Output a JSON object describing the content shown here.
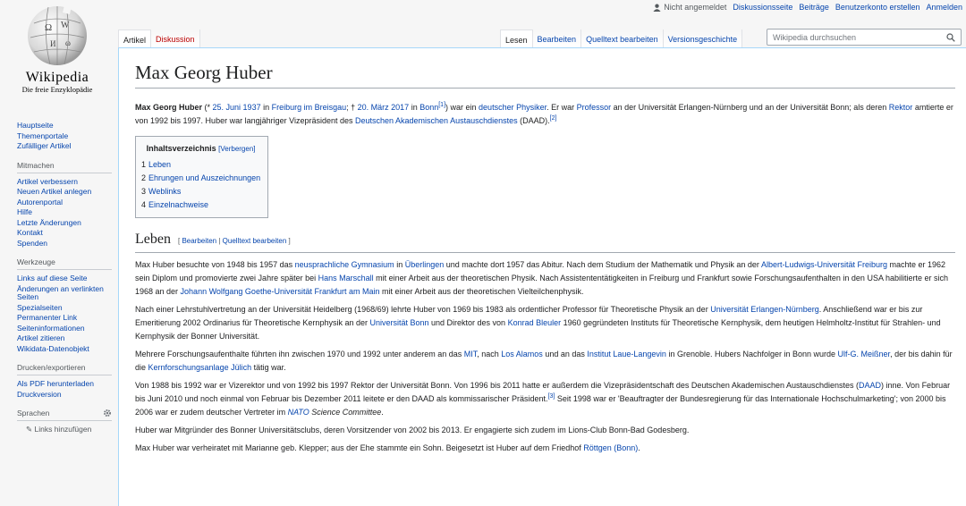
{
  "personal": {
    "user_status": "Nicht angemeldet",
    "links": [
      "Diskussionsseite",
      "Beiträge",
      "Benutzerkonto erstellen",
      "Anmelden"
    ]
  },
  "logo": {
    "wordmark": "Wikipedia",
    "tagline": "Die freie Enzyklopädie"
  },
  "sidebar": {
    "nav": [
      "Hauptseite",
      "Themenportale",
      "Zufälliger Artikel"
    ],
    "mitmachen": {
      "title": "Mitmachen",
      "items": [
        "Artikel verbessern",
        "Neuen Artikel anlegen",
        "Autorenportal",
        "Hilfe",
        "Letzte Änderungen",
        "Kontakt",
        "Spenden"
      ]
    },
    "werkzeuge": {
      "title": "Werkzeuge",
      "items": [
        "Links auf diese Seite",
        "Änderungen an verlinkten Seiten",
        "Spezialseiten",
        "Permanenter Link",
        "Seiteninformationen",
        "Artikel zitieren",
        "Wikidata-Datenobjekt"
      ]
    },
    "drucken": {
      "title": "Drucken/exportieren",
      "items": [
        "Als PDF herunterladen",
        "Druckversion"
      ]
    },
    "sprachen": {
      "title": "Sprachen",
      "add_links": "Links hinzufügen"
    }
  },
  "tabs": {
    "left": [
      "Artikel",
      "Diskussion"
    ],
    "right": [
      "Lesen",
      "Bearbeiten",
      "Quelltext bearbeiten",
      "Versionsgeschichte"
    ]
  },
  "search": {
    "placeholder": "Wikipedia durchsuchen"
  },
  "article": {
    "title": "Max Georg Huber",
    "intro": {
      "bold_name": "Max Georg Huber",
      "t1": " (* ",
      "l_birth_date": "25. Juni 1937",
      "t2": " in ",
      "l_birth_place": "Freiburg im Breisgau",
      "t3": "; † ",
      "l_death_date": "20. März 2017",
      "t4": " in ",
      "l_death_place": "Bonn",
      "ref1": "[1]",
      "t5": ") war ein ",
      "l_nat": "deutscher Physiker",
      "t6": ". Er war ",
      "l_prof": "Professor",
      "t7": " an der Universität Erlangen-Nürnberg und an der Universität Bonn; als deren ",
      "l_rektor": "Rektor",
      "t8": " amtierte er von 1992 bis 1997. Huber war langjähriger Vizepräsident des ",
      "l_daad": "Deutschen Akademischen Austauschdienstes",
      "t9": " (DAAD).",
      "ref2": "[2]"
    },
    "toc": {
      "title": "Inhaltsverzeichnis",
      "toggle": "[Verbergen]",
      "items": [
        {
          "num": "1",
          "label": "Leben"
        },
        {
          "num": "2",
          "label": "Ehrungen und Auszeichnungen"
        },
        {
          "num": "3",
          "label": "Weblinks"
        },
        {
          "num": "4",
          "label": "Einzelnachweise"
        }
      ]
    },
    "section": {
      "heading": "Leben",
      "edit_open": "[ ",
      "edit1": "Bearbeiten",
      "edit_sep": " | ",
      "edit2": "Quelltext bearbeiten",
      "edit_close": " ]"
    },
    "p1": {
      "a": "Max Huber besuchte von 1948 bis 1957 das ",
      "l1": "neusprachliche Gymnasium",
      "b": " in ",
      "l2": "Überlingen",
      "c": " und machte dort 1957 das Abitur. Nach dem Studium der Mathematik und Physik an der ",
      "l3": "Albert-Ludwigs-Universität Freiburg",
      "d": " machte er 1962 sein Diplom und promovierte zwei Jahre später bei ",
      "l4": "Hans Marschall",
      "e": " mit einer Arbeit aus der theoretischen Physik. Nach Assistententätigkeiten in Freiburg und Frankfurt sowie Forschungsaufenthalten in den USA habilitierte er sich 1968 an der ",
      "l5": "Johann Wolfgang Goethe-Universität Frankfurt am Main",
      "f": " mit einer Arbeit aus der theoretischen Vielteilchenphysik."
    },
    "p2": {
      "a": "Nach einer Lehrstuhlvertretung an der Universität Heidelberg (1968/69) lehrte Huber von 1969 bis 1983 als ordentlicher Professor für Theoretische Physik an der ",
      "l1": "Universität Erlangen-Nürnberg",
      "b": ". Anschließend war er bis zur Emeritierung 2002 Ordinarius für Theoretische Kernphysik an der ",
      "l2": "Universität Bonn",
      "c": " und Direktor des von ",
      "l3": "Konrad Bleuler",
      "d": " 1960 gegründeten Instituts für Theoretische Kernphysik, dem heutigen Helmholtz-Institut für Strahlen- und Kernphysik der Bonner Universität."
    },
    "p3": {
      "a": "Mehrere Forschungsaufenthalte führten ihn zwischen 1970 und 1992 unter anderem an das ",
      "l1": "MIT",
      "b": ", nach ",
      "l2": "Los Alamos",
      "c": " und an das ",
      "l3": "Institut Laue-Langevin",
      "d": " in Grenoble. Hubers Nachfolger in Bonn wurde ",
      "l4": "Ulf-G. Meißner",
      "e": ", der bis dahin für die ",
      "l5": "Kernforschungsanlage Jülich",
      "f": " tätig war."
    },
    "p4": {
      "a": "Von 1988 bis 1992 war er Vizerektor und von 1992 bis 1997 Rektor der Universität Bonn. Von 1996 bis 2011 hatte er außerdem die Vizepräsidentschaft des Deutschen Akademischen Austauschdienstes (",
      "l1": "DAAD",
      "b": ") inne. Von Februar bis Juni 2010 und noch einmal von Februar bis Dezember 2011 leitete er den DAAD als kommissarischer Präsident.",
      "ref": "[3]",
      "c": " Seit 1998 war er 'Beauftragter der Bundesregierung für das Internationale Hochschulmarketing'; von 2000 bis 2006 war er zudem deutscher Vertreter im ",
      "l2": "NATO",
      "d": " Science Committee",
      "e": "."
    },
    "p5": "Huber war Mitgründer des Bonner Universitätsclubs, deren Vorsitzender von 2002 bis 2013. Er engagierte sich zudem im Lions-Club Bonn-Bad Godesberg.",
    "p6": {
      "a": "Max Huber war verheiratet mit Marianne geb. Klepper; aus der Ehe stammte ein Sohn. Beigesetzt ist Huber auf dem Friedhof ",
      "l1": "Röttgen (Bonn)",
      "b": "."
    }
  }
}
